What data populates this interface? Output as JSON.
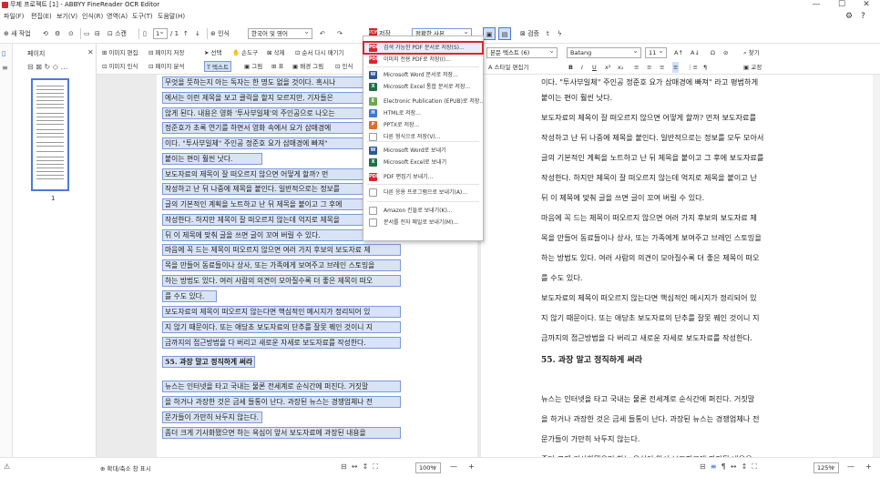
{
  "window": {
    "title": "무제 프로젝트 [1] - ABBYY FineReader OCR Editor",
    "controls": [
      "—",
      "☐",
      "✕"
    ]
  },
  "menu": [
    "파일(F)",
    "편집(E)",
    "보기(V)",
    "인식(R)",
    "영역(A)",
    "도구(T)",
    "도움말(H)"
  ],
  "toolbar": {
    "new_task": "새 작업",
    "scan": "스캔",
    "page_indicator": "1",
    "page_total": "/ 1",
    "recognize": "인식",
    "language": "한국어 및 영어",
    "save_label": "저장",
    "save_mode": "정확한 사본",
    "verify": "검증"
  },
  "left_panel": {
    "title": "페이지",
    "page_number": "1"
  },
  "image_toolbar": {
    "edit_image": "이미지 편집",
    "save_page": "페이지 저장",
    "recognize_image": "이미지 인식",
    "analyze_page": "페이지 분석",
    "select": "선택",
    "hand": "손도구",
    "delete": "삭제",
    "order": "순서 다시 매기기",
    "text": "텍스트",
    "picture": "그림",
    "table": "표",
    "background_picture": "배경 그림",
    "recognition": "인식"
  },
  "dropdown": [
    {
      "label": "검색 가능한 PDF 문서로 저장(S)...",
      "icon": "PDF",
      "color": "#d9262c"
    },
    {
      "label": "이미지 전용 PDF로 저장(I)...",
      "icon": "PDF",
      "color": "#d9262c"
    },
    {
      "label": "Microsoft Word 문서로 저장...",
      "icon": "W",
      "color": "#2b5797"
    },
    {
      "label": "Microsoft Excel 통합 문서로 저장...",
      "icon": "X",
      "color": "#1e7145"
    },
    {
      "label": "Electronic Publication (EPUB)로 저장...",
      "icon": "E",
      "color": "#6aa84f"
    },
    {
      "label": "HTML로 저장...",
      "icon": "H",
      "color": "#3c78d8"
    },
    {
      "label": "PPTX로 저장...",
      "icon": "P",
      "color": "#e06c2d"
    },
    {
      "label": "다른 형식으로 저장(V)...",
      "icon": "",
      "color": "#ffffff"
    },
    {
      "label": "Microsoft Word로 보내기",
      "icon": "W",
      "color": "#2b5797"
    },
    {
      "label": "Microsoft Excel로 보내기",
      "icon": "X",
      "color": "#1e7145"
    },
    {
      "label": "PDF 편집기 보내기...",
      "icon": "PDF",
      "color": "#d9262c"
    },
    {
      "label": "다른 응용 프로그램으로 보내기(A)...",
      "icon": "",
      "color": "#ffffff"
    },
    {
      "label": "Amazon 킨들로 보내기(K)...",
      "icon": "",
      "color": "#ffffff"
    },
    {
      "label": "문서를 전자 메일로 보내기(M)...",
      "icon": "",
      "color": "#ffffff"
    }
  ],
  "text_toolbar": {
    "style": "본문 텍스트 (6)",
    "font": "Batang",
    "size": "11",
    "find": "찾기",
    "style_editor": "스타일 편집기",
    "correction": "교정"
  },
  "image_lines": [
    "무엇을 뜻하는지 아는 독자는 한 명도 없을 것이다. 혹시나",
    "에서는 이런 제목을 보고 클릭을 할지 모르지만, 기자들은",
    "않게 된다. 내용은 영화 '투사부일체'의 주인공으로 나오는",
    "정준호가 초록 연기를 하면서 영화 속에서 요가 삼매경에",
    "이다. \"투사부일체\" 주인공 정준호 요가 삼매경에 빠져\"",
    "붙이는 편이 훨씬 낫다.",
    "  보도자료의 제목이 잘 떠오르지 않으면 어떻게 할까? 먼",
    "작성하고 난 뒤 나중에 제목을 붙인다. 일반적으로는 정보를",
    "글의 기본적인 계획을 노트하고 난 뒤 제목을 붙이고 그 후에",
    "작성한다. 하지만 제목이 잘 떠오르지 않는데 억지로 제목을",
    "뒤 이 제목에 맞춰 글을 쓰면 글이 꼬여 버릴 수 있다.",
    "  마음에 꼭 드는 제목이 떠오르지 않으면 여러 가지 후보의 보도자료 제",
    "목을 만들어 동료들이나 상사, 또는 가족에게 보여주고 브레인 스토밍을",
    "하는 방법도 있다. 여러 사람의 의견이 모아질수록 더 좋은 제목이 떠오",
    "를 수도 있다.",
    "  보도자료의 제목이 떠오르지 않는다면 핵심적인 메시지가 정리되어 있",
    "지 않기 때문이다. 또는 애당초 보도자료의 단추를 잘못 꿰인 것이니 지",
    "금까지의 접근방법을 다 버리고 새로운 자세로 보도자료를 작성한다.",
    "55. 과장 말고 정직하게 써라",
    "  뉴스는 인터넷을 타고 국내는 물론 전세계로 순식간에 퍼진다. 거짓말",
    "을 하거나 과장한 것은 금세 들통이 난다. 과장된 뉴스는 경쟁업체나 전",
    "문가들이 가만히 놔두지 않는다.",
    "  좀더 크게 기사화됐으면 하는 욕심이 앞서 보도자료에 과장된 내용을"
  ],
  "text_lines": [
    "이다. \"투사부일체\" 주인공 정준호 요가 삼매경에 빠져\" 라고 평범하게",
    "붙이는 편이 훨씬 낫다.",
    "  보도자료의 제목이 잘 떠오르지 않으면 어떻게 할까? 먼저 보도자료를",
    "작성하고 난 뒤 나중에 제목을 붙인다. 일반적으로는 정보를 모두 모아서",
    "글의 기본적인 계획을 노트하고 난 뒤 제목을 붙이고 그 후에 보도자료를",
    "작성한다. 하지만 제목이 잘 떠오르지       않는데 억지로 제목을 붙이고 난",
    "뒤 이 제목에 맞춰 글을 쓰면 글이 꼬여 버릴 수 있다.",
    "  마음에 꼭 드는 제목이 떠오르지 않으면 여러 가지 후보의 보도자료 제",
    "목을 만들어 동료들이나 상사,     또는 가족에게 보여주고 브레인 스토밍을",
    "하는 방법도 있다. 여러 사람의 의견이 모아질수록 더         좋은 제목이 떠오",
    "를 수도 있다.",
    "  보도자료의 제목이 떠오르지 않는다면 핵심적인 메시지가 정리되어 있",
    "지 않기 때문이다. 또는 애당초 보도자료의 단추를 잘못 꿰인 것이니 지",
    "금까지의 접근방법을 다 버리고 새로운 자세로 보도자료를 작성한다.",
    "55. 과장 말고 정직하게 써라",
    "  뉴스는 인터넷을 타고 국내는 물론 전세계로 순식간에 퍼진다. 거짓말",
    "을 하거나 과장한 것은 금세 들통이 난다. 과장된 뉴스는 경쟁업체나 전",
    "문가들이 가만히 놔두지 않는다.",
    "  좀더 크게 기사화됐으면 하는 욕심이 앞서 보도자료에 과장된 내용을"
  ],
  "status": {
    "zoom_panel": "확대/축소 창 표시",
    "zoom_left": "100%",
    "zoom_right": "125%"
  },
  "colors": {
    "accent": "#2b63c9",
    "highlight_red": "#d9262c"
  }
}
